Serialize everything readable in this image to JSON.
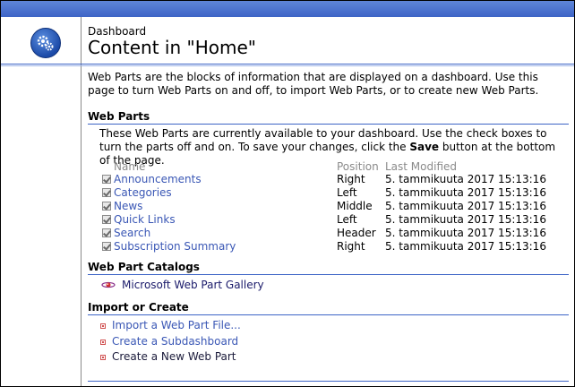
{
  "header": {
    "breadcrumb": "Dashboard",
    "title": "Content in \"Home\""
  },
  "intro": "Web Parts are the blocks of information that are displayed on a dashboard. Use this page to turn Web Parts on and off, to import Web Parts, or to create new Web Parts.",
  "web_parts": {
    "section_title": "Web Parts",
    "desc_prefix": "These Web Parts are currently available to your dashboard. Use the check boxes to turn the parts off and on. To save your changes, click the ",
    "desc_bold": "Save",
    "desc_suffix": " button at the bottom of the page.",
    "columns": {
      "name": "Name",
      "position": "Position",
      "modified": "Last Modified"
    },
    "rows": [
      {
        "name": "Announcements",
        "position": "Right",
        "modified": "5. tammikuuta 2017 15:13:16",
        "checked": true
      },
      {
        "name": "Categories",
        "position": "Left",
        "modified": "5. tammikuuta 2017 15:13:16",
        "checked": true
      },
      {
        "name": "News",
        "position": "Middle",
        "modified": "5. tammikuuta 2017 15:13:16",
        "checked": true
      },
      {
        "name": "Quick Links",
        "position": "Left",
        "modified": "5. tammikuuta 2017 15:13:16",
        "checked": true
      },
      {
        "name": "Search",
        "position": "Header",
        "modified": "5. tammikuuta 2017 15:13:16",
        "checked": true
      },
      {
        "name": "Subscription Summary",
        "position": "Right",
        "modified": "5. tammikuuta 2017 15:13:16",
        "checked": true
      }
    ]
  },
  "catalogs": {
    "section_title": "Web Part Catalogs",
    "gallery_link": "Microsoft Web Part Gallery"
  },
  "import_create": {
    "section_title": "Import or Create",
    "import_link": "Import a Web Part File...",
    "subdashboard_link": "Create a Subdashboard",
    "new_web_part_link": "Create a New Web Part"
  },
  "colors": {
    "topbar": "#3d64c6",
    "link": "#3a57b5",
    "rule": "#3d64c6"
  }
}
